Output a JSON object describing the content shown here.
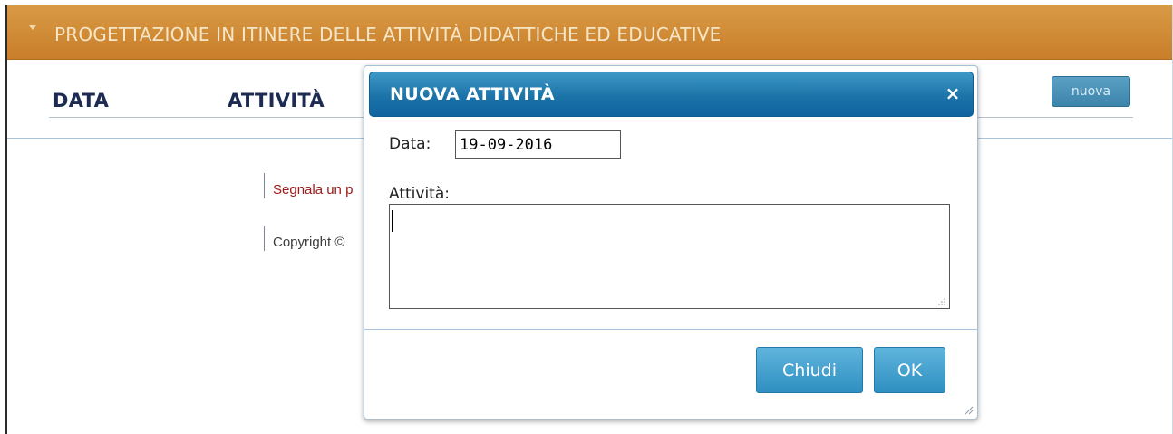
{
  "header": {
    "title": "PROGETTAZIONE IN ITINERE DELLE ATTIVITÀ DIDATTICHE ED EDUCATIVE"
  },
  "table": {
    "columns": [
      "DATA",
      "ATTIVITÀ"
    ]
  },
  "toolbar": {
    "new_label": "nuova"
  },
  "footer": {
    "report_link": "Segnala un p",
    "copyright": "Copyright ©"
  },
  "dialog": {
    "title": "NUOVA ATTIVITÀ",
    "close_glyph": "×",
    "date_label": "Data:",
    "date_value": "19-09-2016",
    "activity_label": "Attività:",
    "activity_value": "",
    "buttons": {
      "close": "Chiudi",
      "ok": "OK"
    }
  },
  "colors": {
    "header_bar": "#c97e2a",
    "dialog_titlebar": "#1b73a8",
    "button": "#3a9ccd",
    "column_heading": "#1d2b52",
    "link": "#a01818"
  }
}
